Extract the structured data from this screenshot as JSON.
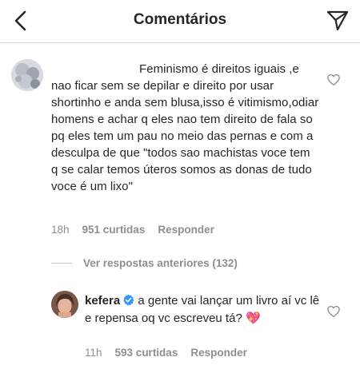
{
  "header": {
    "title": "Comentários"
  },
  "comment": {
    "text": "Feminismo é direitos iguais ,e nao ficar sem se depilar e direito por usar shortinho e anda sem blusa,isso é vitimismo,odiar homens e achar q eles nao tem direito de fala so pq eles tem um pau no meio das pernas e com a desculpa de que \"todos sao machistas voce tem q se calar temos úteros somos as donas de tudo voce é um lixo\"",
    "time": "18h",
    "likes": "951 curtidas",
    "reply_label": "Responder"
  },
  "view_replies": "Ver respostas anteriores (132)",
  "reply": {
    "username": "kefera",
    "text": "a gente vai lançar um livro aí vc lê e repensa oq vc escreveu tá? 💖",
    "time": "11h",
    "likes": "593 curtidas",
    "reply_label": "Responder"
  },
  "colors": {
    "text": "#262626",
    "secondary": "#8e8e8e",
    "verified": "#3897f0",
    "divider": "#dbdbdb"
  },
  "icons": [
    "back-icon",
    "direct-share-icon",
    "heart-icon",
    "verified-badge-icon"
  ]
}
